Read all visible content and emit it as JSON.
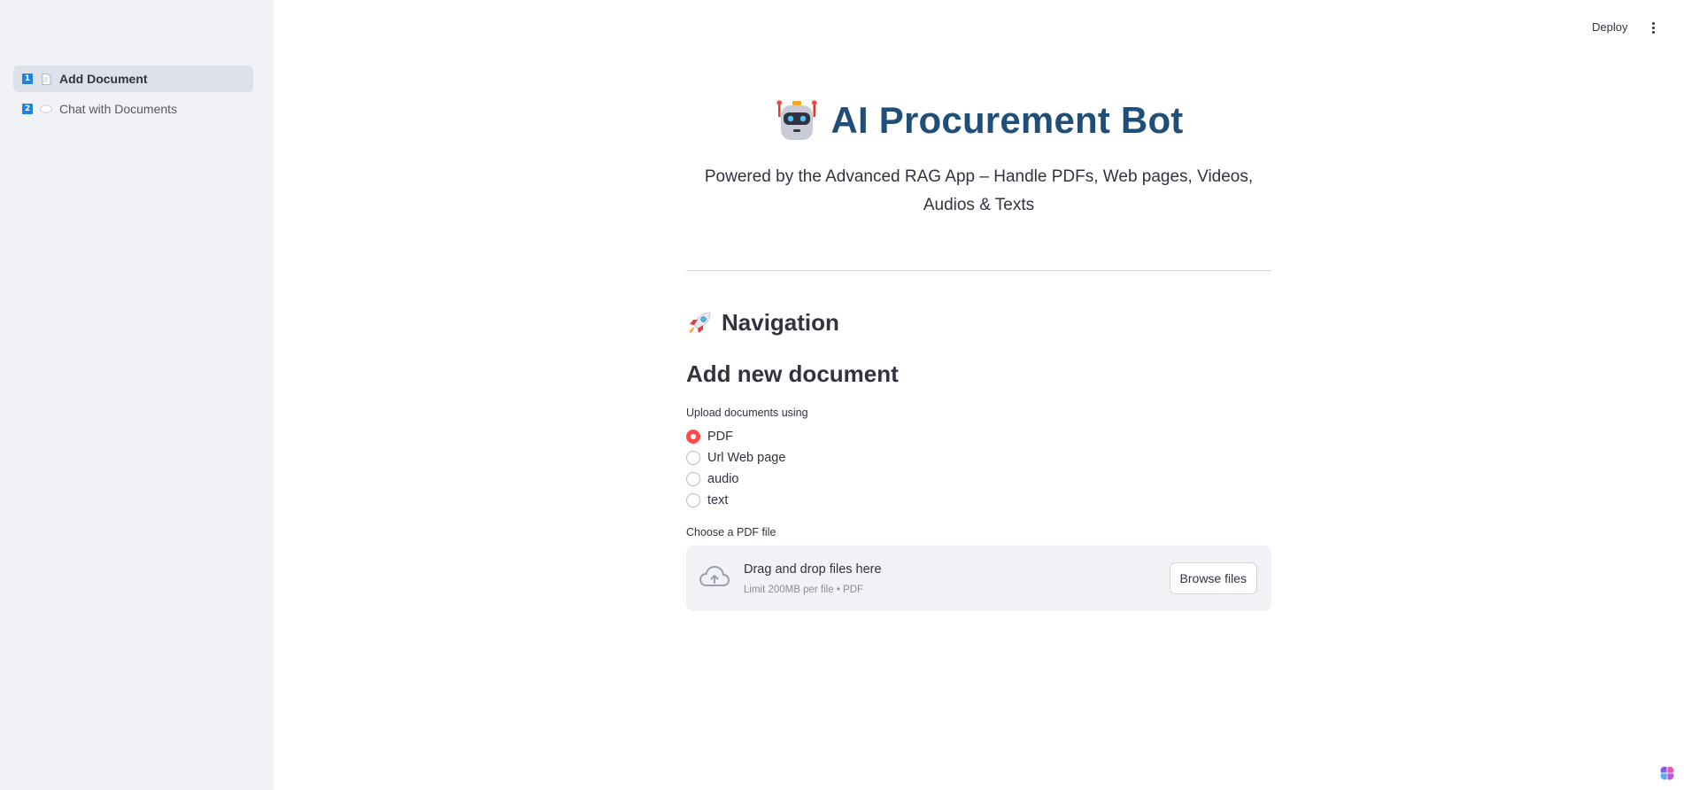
{
  "sidebar": {
    "items": [
      {
        "number": "1",
        "icon": "document-icon",
        "label": "Add Document",
        "active": true
      },
      {
        "number": "2",
        "icon": "speech-bubble-icon",
        "label": "Chat with Documents",
        "active": false
      }
    ]
  },
  "header": {
    "deploy_label": "Deploy",
    "menu_icon": "more-vertical-icon"
  },
  "main": {
    "title_icon": "robot-icon",
    "title": "AI Procurement Bot",
    "subtitle": "Powered by the Advanced RAG App – Handle PDFs, Web pages, Videos, Audios & Texts",
    "nav_heading_icon": "rocket-icon",
    "nav_heading": "Navigation",
    "section_heading": "Add new document",
    "upload_label": "Upload documents using",
    "radio_options": [
      {
        "label": "PDF",
        "checked": true
      },
      {
        "label": "Url Web page",
        "checked": false
      },
      {
        "label": "audio",
        "checked": false
      },
      {
        "label": "text",
        "checked": false
      }
    ],
    "file_label": "Choose a PDF file",
    "dropzone": {
      "icon": "cloud-upload-icon",
      "title": "Drag and drop files here",
      "subtitle": "Limit 200MB per file • PDF",
      "browse_label": "Browse files"
    }
  },
  "colors": {
    "sidebar_bg": "#f0f2f6",
    "title": "#1f4e79",
    "accent": "#ff4b4b",
    "badge": "#1c83e1"
  }
}
